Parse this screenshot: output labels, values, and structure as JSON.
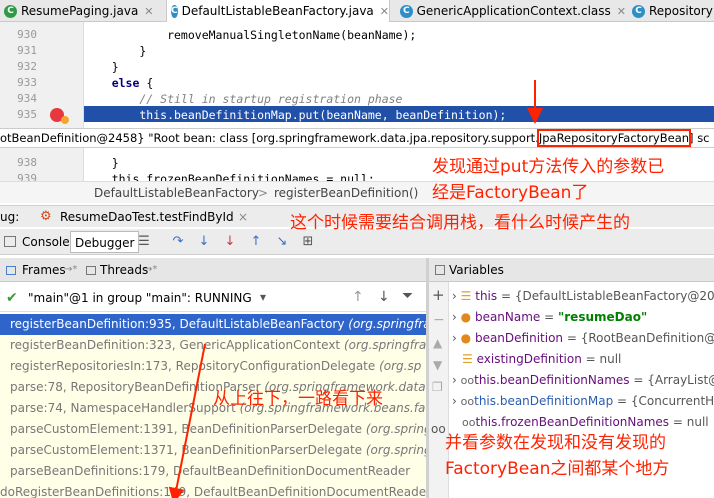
{
  "tabs": [
    {
      "label": "ResumePaging.java",
      "icon": "C",
      "color": "#2f9a46"
    },
    {
      "label": "DefaultListableBeanFactory.java",
      "icon": "C",
      "color": "#2e8fc8"
    },
    {
      "label": "GenericApplicationContext.class",
      "icon": "C",
      "color": "#2e8fc8"
    },
    {
      "label": "Repository",
      "icon": "C",
      "color": "#2e8fc8"
    }
  ],
  "code": {
    "lines": [
      {
        "num": "930",
        "text": "            removeManualSingletonName(beanName);"
      },
      {
        "num": "931",
        "text": "        }"
      },
      {
        "num": "932",
        "text": "    }"
      },
      {
        "num": "933",
        "kw": "else",
        "text": " {"
      },
      {
        "num": "934",
        "comment": "        // Still in startup registration phase"
      },
      {
        "num": "935",
        "text": "        this.beanDefinitionMap.put(beanName, beanDefinition);"
      },
      {
        "num": "938",
        "text": "    }"
      },
      {
        "num": "939",
        "text": "    this.frozenBeanDefinitionNames = null;"
      }
    ]
  },
  "tooltip": {
    "prefix": "otBeanDefinition@2458} \"Root bean: class [org.springframework.data.jpa.repository.support.",
    "highlight": "JpaRepositoryFactoryBean",
    "suffix": "] sc"
  },
  "breadcrumb": {
    "item1": "DefaultListableBeanFactory",
    "sep": ">",
    "item2": "registerBeanDefinition()"
  },
  "debug": {
    "label": "ug:",
    "config": "ResumeDaoTest.testFindById",
    "close": "×"
  },
  "toolbar": {
    "console": "Console",
    "debugger": "Debugger"
  },
  "frames_panel": {
    "frames": "Frames",
    "threads": "Threads",
    "arrow": "→*"
  },
  "thread": {
    "name": "\"main\"@1 in group \"main\": RUNNING"
  },
  "frames": [
    {
      "method": "registerBeanDefinition:935, DefaultListableBeanFactory",
      "pkg": "(org.springframe"
    },
    {
      "method": "registerBeanDefinition:323, GenericApplicationContext",
      "pkg": "(org.springfram"
    },
    {
      "method": "registerRepositoriesIn:173, RepositoryConfigurationDelegate",
      "pkg": "(org.sp"
    },
    {
      "method": "parse:78, RepositoryBeanDefinitionParser",
      "pkg": "(org.springframework.data.re"
    },
    {
      "method": "parse:74, NamespaceHandlerSupport",
      "pkg": "(org.springframework.beans.fact"
    },
    {
      "method": "parseCustomElement:1391, BeanDefinitionParserDelegate",
      "pkg": "(org.springfra"
    },
    {
      "method": "parseCustomElement:1371, BeanDefinitionParserDelegate",
      "pkg": "(org.springfra"
    },
    {
      "method": "parseBeanDefinitions:179, DefaultBeanDefinitionDocumentReader",
      "pkg": ""
    },
    {
      "method": "doRegisterBeanDefinitions:149, DefaultBeanDefinitionDocumentReader",
      "pkg": ""
    }
  ],
  "variables_panel": {
    "title": "Variables"
  },
  "variables": [
    {
      "name": "this",
      "value": " = {DefaultListableBeanFactory@20"
    },
    {
      "name": "beanName",
      "value": " = ",
      "str": "\"resumeDao\""
    },
    {
      "name": "beanDefinition",
      "value": " = {RootBeanDefinition@"
    },
    {
      "name": "existingDefinition",
      "value": " = null"
    },
    {
      "name": "this.beanDefinitionNames",
      "value": " = {ArrayList@"
    },
    {
      "name": "this.beanDefinitionMap",
      "value": " = {ConcurrentH"
    },
    {
      "name": "this.frozenBeanDefinitionNames",
      "value": " = null"
    }
  ],
  "annotations": {
    "a1_line1": "发现通过put方法传入的参数已",
    "a1_line2": "经是FactoryBean了",
    "a2": "这个时候需要结合调用栈，看什么时候产生的",
    "a3": "从上往下，一路看下来",
    "a4_line1": "并看参数在发现和没有发现的",
    "a4_line2": "FactoryBean之间都某个地方"
  },
  "colors": {
    "annotation": "#ff2200",
    "selection": "#2f65ca",
    "highlight": "#2150a8"
  }
}
